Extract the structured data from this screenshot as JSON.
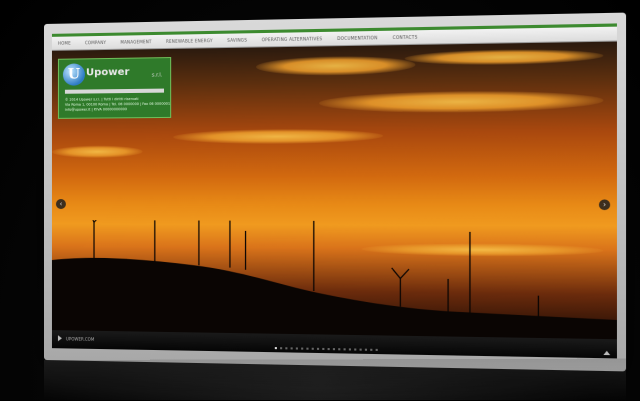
{
  "nav": {
    "items": [
      "HOME",
      "COMPANY",
      "MANAGEMENT",
      "RENEWABLE ENERGY",
      "SAVINGS",
      "OPERATING ALTERNATIVES",
      "DOCUMENTATION",
      "CONTACTS"
    ]
  },
  "logo": {
    "letter": "U",
    "text": "Upower",
    "suffix": "s.r.l.",
    "lines": [
      "© 2014 Upower s.r.l. | Tutti i diritti riservati",
      "Via Roma 1, 00100 Roma | Tel. 06 0000000 | Fax 06 0000001",
      "info@upower.it | P.IVA 00000000000"
    ]
  },
  "slider": {
    "prev_icon": "chevron-left-icon",
    "next_icon": "chevron-right-icon",
    "caption": "UPOWER.COM",
    "dot_count": 20,
    "active_dot": 0
  },
  "colors": {
    "accent": "#3c8a2f",
    "logo_bg": "#2f7a2a",
    "sky": "#e88a16"
  }
}
